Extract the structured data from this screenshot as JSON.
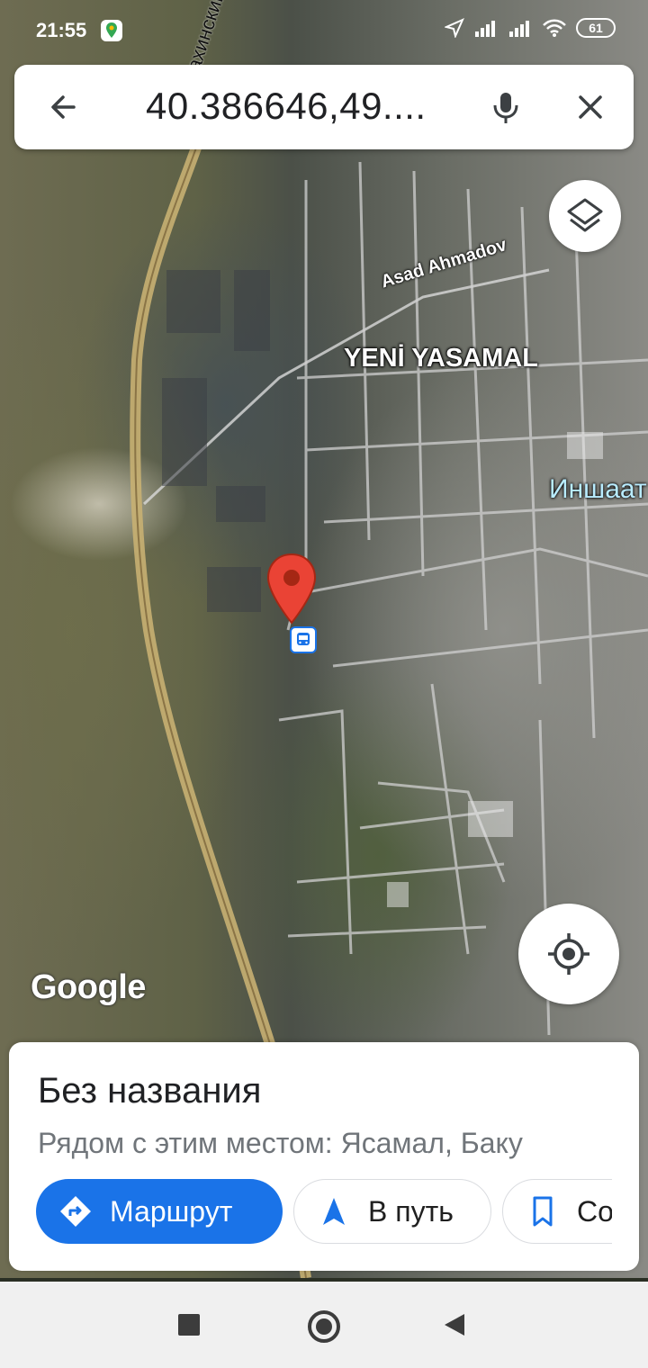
{
  "status_bar": {
    "time": "21:55",
    "battery": "61",
    "icons": [
      "location-arrow-icon",
      "signal-icon",
      "signal-icon",
      "wifi-icon",
      "battery-icon"
    ]
  },
  "search": {
    "query": "40.386646,49....",
    "icons": [
      "back-arrow-icon",
      "microphone-icon",
      "close-icon"
    ]
  },
  "map": {
    "labels": {
      "district": "YENİ YASAMAL",
      "street_asad": "Asad Ahmadov",
      "metro": "Иншаат",
      "highway": "Шамахинский пут"
    },
    "logo": "Google",
    "pin_icon": "red-map-pin-icon",
    "bus_icon": "bus-stop-icon",
    "controls": [
      "layers-icon",
      "my-location-icon"
    ]
  },
  "place": {
    "title": "Без названия",
    "subtitle": "Рядом с этим местом: Ясамал, Баку",
    "actions": {
      "route": "Маршрут",
      "start": "В путь",
      "save": "Со"
    }
  },
  "colors": {
    "accent": "#1a73e8",
    "pin": "#ea4335",
    "road": "#c8b072"
  }
}
